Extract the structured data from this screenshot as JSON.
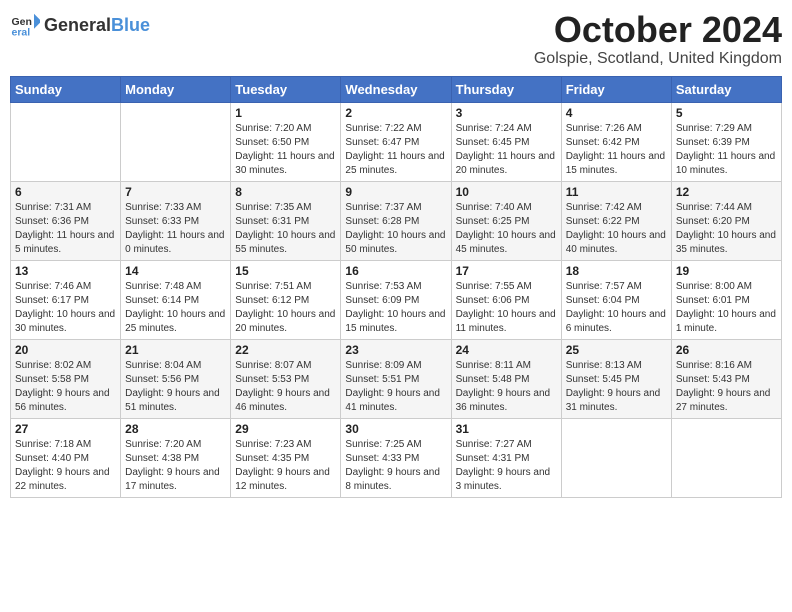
{
  "logo": {
    "general": "General",
    "blue": "Blue"
  },
  "header": {
    "month": "October 2024",
    "location": "Golspie, Scotland, United Kingdom"
  },
  "weekdays": [
    "Sunday",
    "Monday",
    "Tuesday",
    "Wednesday",
    "Thursday",
    "Friday",
    "Saturday"
  ],
  "weeks": [
    [
      {
        "day": "",
        "content": ""
      },
      {
        "day": "",
        "content": ""
      },
      {
        "day": "1",
        "content": "Sunrise: 7:20 AM\nSunset: 6:50 PM\nDaylight: 11 hours and 30 minutes."
      },
      {
        "day": "2",
        "content": "Sunrise: 7:22 AM\nSunset: 6:47 PM\nDaylight: 11 hours and 25 minutes."
      },
      {
        "day": "3",
        "content": "Sunrise: 7:24 AM\nSunset: 6:45 PM\nDaylight: 11 hours and 20 minutes."
      },
      {
        "day": "4",
        "content": "Sunrise: 7:26 AM\nSunset: 6:42 PM\nDaylight: 11 hours and 15 minutes."
      },
      {
        "day": "5",
        "content": "Sunrise: 7:29 AM\nSunset: 6:39 PM\nDaylight: 11 hours and 10 minutes."
      }
    ],
    [
      {
        "day": "6",
        "content": "Sunrise: 7:31 AM\nSunset: 6:36 PM\nDaylight: 11 hours and 5 minutes."
      },
      {
        "day": "7",
        "content": "Sunrise: 7:33 AM\nSunset: 6:33 PM\nDaylight: 11 hours and 0 minutes."
      },
      {
        "day": "8",
        "content": "Sunrise: 7:35 AM\nSunset: 6:31 PM\nDaylight: 10 hours and 55 minutes."
      },
      {
        "day": "9",
        "content": "Sunrise: 7:37 AM\nSunset: 6:28 PM\nDaylight: 10 hours and 50 minutes."
      },
      {
        "day": "10",
        "content": "Sunrise: 7:40 AM\nSunset: 6:25 PM\nDaylight: 10 hours and 45 minutes."
      },
      {
        "day": "11",
        "content": "Sunrise: 7:42 AM\nSunset: 6:22 PM\nDaylight: 10 hours and 40 minutes."
      },
      {
        "day": "12",
        "content": "Sunrise: 7:44 AM\nSunset: 6:20 PM\nDaylight: 10 hours and 35 minutes."
      }
    ],
    [
      {
        "day": "13",
        "content": "Sunrise: 7:46 AM\nSunset: 6:17 PM\nDaylight: 10 hours and 30 minutes."
      },
      {
        "day": "14",
        "content": "Sunrise: 7:48 AM\nSunset: 6:14 PM\nDaylight: 10 hours and 25 minutes."
      },
      {
        "day": "15",
        "content": "Sunrise: 7:51 AM\nSunset: 6:12 PM\nDaylight: 10 hours and 20 minutes."
      },
      {
        "day": "16",
        "content": "Sunrise: 7:53 AM\nSunset: 6:09 PM\nDaylight: 10 hours and 15 minutes."
      },
      {
        "day": "17",
        "content": "Sunrise: 7:55 AM\nSunset: 6:06 PM\nDaylight: 10 hours and 11 minutes."
      },
      {
        "day": "18",
        "content": "Sunrise: 7:57 AM\nSunset: 6:04 PM\nDaylight: 10 hours and 6 minutes."
      },
      {
        "day": "19",
        "content": "Sunrise: 8:00 AM\nSunset: 6:01 PM\nDaylight: 10 hours and 1 minute."
      }
    ],
    [
      {
        "day": "20",
        "content": "Sunrise: 8:02 AM\nSunset: 5:58 PM\nDaylight: 9 hours and 56 minutes."
      },
      {
        "day": "21",
        "content": "Sunrise: 8:04 AM\nSunset: 5:56 PM\nDaylight: 9 hours and 51 minutes."
      },
      {
        "day": "22",
        "content": "Sunrise: 8:07 AM\nSunset: 5:53 PM\nDaylight: 9 hours and 46 minutes."
      },
      {
        "day": "23",
        "content": "Sunrise: 8:09 AM\nSunset: 5:51 PM\nDaylight: 9 hours and 41 minutes."
      },
      {
        "day": "24",
        "content": "Sunrise: 8:11 AM\nSunset: 5:48 PM\nDaylight: 9 hours and 36 minutes."
      },
      {
        "day": "25",
        "content": "Sunrise: 8:13 AM\nSunset: 5:45 PM\nDaylight: 9 hours and 31 minutes."
      },
      {
        "day": "26",
        "content": "Sunrise: 8:16 AM\nSunset: 5:43 PM\nDaylight: 9 hours and 27 minutes."
      }
    ],
    [
      {
        "day": "27",
        "content": "Sunrise: 7:18 AM\nSunset: 4:40 PM\nDaylight: 9 hours and 22 minutes."
      },
      {
        "day": "28",
        "content": "Sunrise: 7:20 AM\nSunset: 4:38 PM\nDaylight: 9 hours and 17 minutes."
      },
      {
        "day": "29",
        "content": "Sunrise: 7:23 AM\nSunset: 4:35 PM\nDaylight: 9 hours and 12 minutes."
      },
      {
        "day": "30",
        "content": "Sunrise: 7:25 AM\nSunset: 4:33 PM\nDaylight: 9 hours and 8 minutes."
      },
      {
        "day": "31",
        "content": "Sunrise: 7:27 AM\nSunset: 4:31 PM\nDaylight: 9 hours and 3 minutes."
      },
      {
        "day": "",
        "content": ""
      },
      {
        "day": "",
        "content": ""
      }
    ]
  ]
}
